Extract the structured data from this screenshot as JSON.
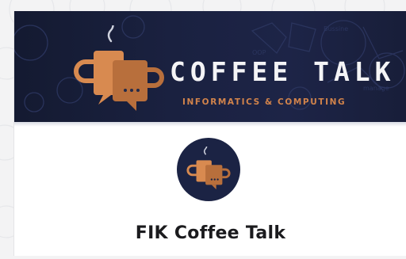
{
  "banner": {
    "title": "COFFEE TALK",
    "subtitle": "INFORMATICS & COMPUTING"
  },
  "profile": {
    "name": "FIK Coffee Talk",
    "avatar_icon": "coffee-talk-logo-icon"
  },
  "colors": {
    "banner_bg": "#1a2140",
    "accent_orange": "#d1834b",
    "title_text": "#f4f4f6"
  }
}
